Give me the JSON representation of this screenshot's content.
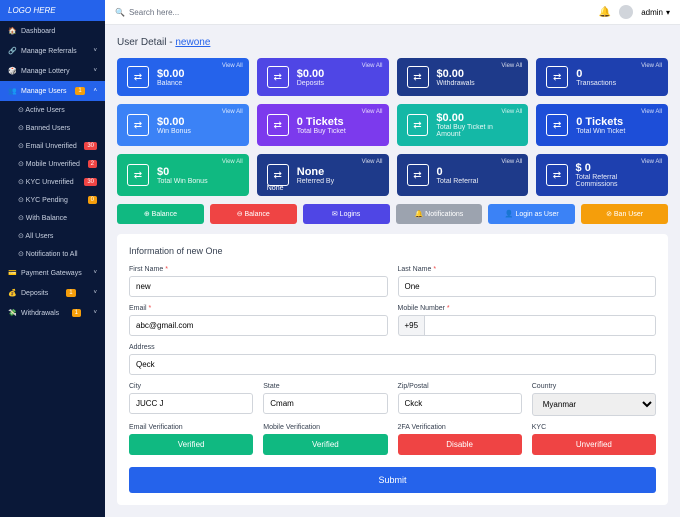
{
  "brand": "LOGO HERE",
  "search": "Search here...",
  "admin": "admin",
  "nav": [
    {
      "l": "Dashboard"
    },
    {
      "l": "Manage Referrals"
    },
    {
      "l": "Manage Lottery"
    }
  ],
  "mu": {
    "l": "Manage Users",
    "b": "1"
  },
  "sub": [
    {
      "l": "Active Users"
    },
    {
      "l": "Banned Users"
    },
    {
      "l": "Email Unverified",
      "b": "30",
      "c": "red"
    },
    {
      "l": "Mobile Unverified",
      "b": "2",
      "c": "red"
    },
    {
      "l": "KYC Unverified",
      "b": "30",
      "c": "red"
    },
    {
      "l": "KYC Pending",
      "b": "0",
      "c": "orange"
    },
    {
      "l": "With Balance"
    },
    {
      "l": "All Users"
    },
    {
      "l": "Notification to All"
    }
  ],
  "nav2": [
    {
      "l": "Payment Gateways"
    },
    {
      "l": "Deposits",
      "b": "1",
      "c": "orange"
    },
    {
      "l": "Withdrawals",
      "b": "1",
      "c": "orange"
    }
  ],
  "pgTitle": "User Detail - ",
  "pgUser": "newone",
  "cards": [
    {
      "v": "$0.00",
      "l": "Balance",
      "c": "c-blue"
    },
    {
      "v": "$0.00",
      "l": "Deposits",
      "c": "c-indigo"
    },
    {
      "v": "$0.00",
      "l": "Withdrawals",
      "c": "c-navy"
    },
    {
      "v": "0",
      "l": "Transactions",
      "c": "c-navy2"
    },
    {
      "v": "$0.00",
      "l": "Win Bonus",
      "c": "c-sky"
    },
    {
      "v": "0 Tickets",
      "l": "Total Buy Ticket",
      "c": "c-violet"
    },
    {
      "v": "$0.00",
      "l": "Total Buy Ticket in Amount",
      "c": "c-teal"
    },
    {
      "v": "0 Tickets",
      "l": "Total Win Ticket",
      "c": "c-blue2"
    },
    {
      "v": "$0",
      "l": "Total Win Bonus",
      "c": "c-emerald"
    },
    {
      "v": "None",
      "l": "Referred By",
      "sub": "None",
      "c": "c-navy"
    },
    {
      "v": "0",
      "l": "Total Referral",
      "c": "c-navy"
    },
    {
      "v": "$ 0",
      "l": "Total Referral Commissions",
      "c": "c-navy2"
    }
  ],
  "viewAll": "View All",
  "actions": [
    {
      "l": "⊕ Balance",
      "c": "b-green"
    },
    {
      "l": "⊖ Balance",
      "c": "b-red"
    },
    {
      "l": "✉ Logins",
      "c": "b-indigo"
    },
    {
      "l": "🔔 Notifications",
      "c": "b-gray"
    },
    {
      "l": "👤 Login as User",
      "c": "b-blue"
    },
    {
      "l": "⊘ Ban User",
      "c": "b-amber"
    }
  ],
  "infoTitle": "Information of new One",
  "fn": {
    "l": "First Name",
    "v": "new"
  },
  "ln": {
    "l": "Last Name",
    "v": "One"
  },
  "em": {
    "l": "Email",
    "v": "abc@gmail.com"
  },
  "mb": {
    "l": "Mobile Number",
    "p": "+95",
    "v": ""
  },
  "ad": {
    "l": "Address",
    "v": "Qeck"
  },
  "ci": {
    "l": "City",
    "v": "JUCC J"
  },
  "st": {
    "l": "State",
    "v": "Cmam"
  },
  "zp": {
    "l": "Zip/Postal",
    "v": "Ckck"
  },
  "co": {
    "l": "Country",
    "v": "Myanmar"
  },
  "ev": {
    "l": "Email Verification",
    "s": "Verified",
    "c": "b-green"
  },
  "mv": {
    "l": "Mobile Verification",
    "s": "Verified",
    "c": "b-green"
  },
  "fv": {
    "l": "2FA Verification",
    "s": "Disable",
    "c": "b-red"
  },
  "kv": {
    "l": "KYC",
    "s": "Unverified",
    "c": "b-red"
  },
  "submit": "Submit"
}
